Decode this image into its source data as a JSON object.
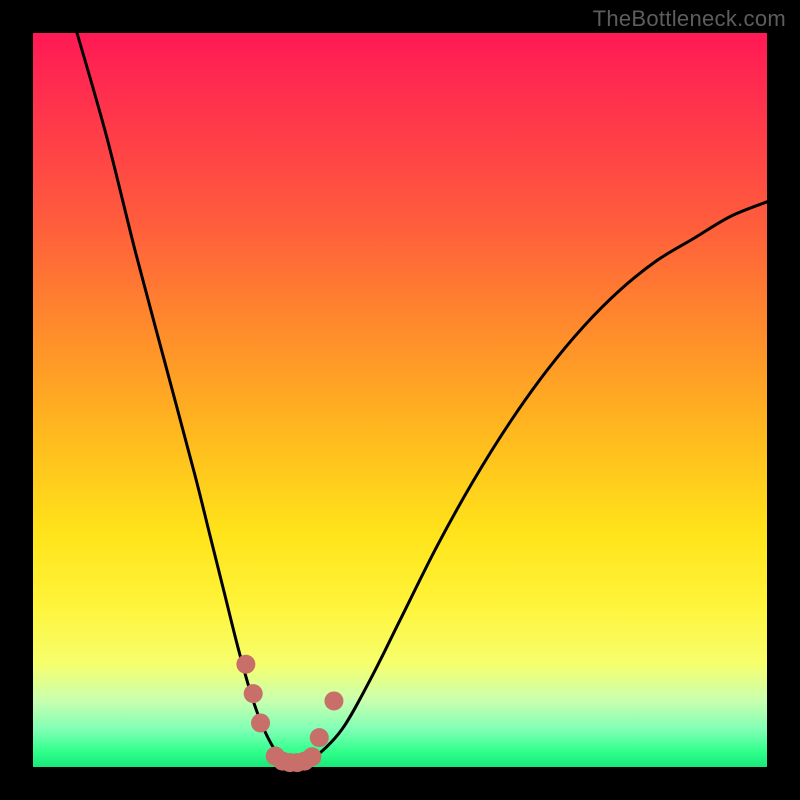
{
  "watermark": "TheBottleneck.com",
  "colors": {
    "frame": "#000000",
    "curve": "#000000",
    "dots": "#c86f6a"
  },
  "chart_data": {
    "type": "line",
    "title": "",
    "xlabel": "",
    "ylabel": "",
    "xlim": [
      0,
      100
    ],
    "ylim": [
      0,
      100
    ],
    "grid": false,
    "legend": false,
    "series": [
      {
        "name": "bottleneck-curve",
        "x": [
          6,
          10,
          14,
          18,
          22,
          24,
          26,
          28,
          30,
          32,
          34,
          36,
          38,
          42,
          46,
          50,
          55,
          60,
          65,
          70,
          75,
          80,
          85,
          90,
          95,
          100
        ],
        "y": [
          100,
          86,
          70,
          55,
          40,
          32,
          24,
          16,
          9,
          4,
          1,
          0,
          1,
          5,
          12,
          20,
          30,
          39,
          47,
          54,
          60,
          65,
          69,
          72,
          75,
          77
        ]
      }
    ],
    "dot_cluster": {
      "name": "data-points",
      "x": [
        29,
        30,
        31,
        33,
        34,
        35,
        36,
        37,
        38,
        39,
        41
      ],
      "y": [
        14,
        10,
        6,
        1.5,
        0.8,
        0.6,
        0.6,
        0.8,
        1.4,
        4,
        9
      ]
    }
  }
}
